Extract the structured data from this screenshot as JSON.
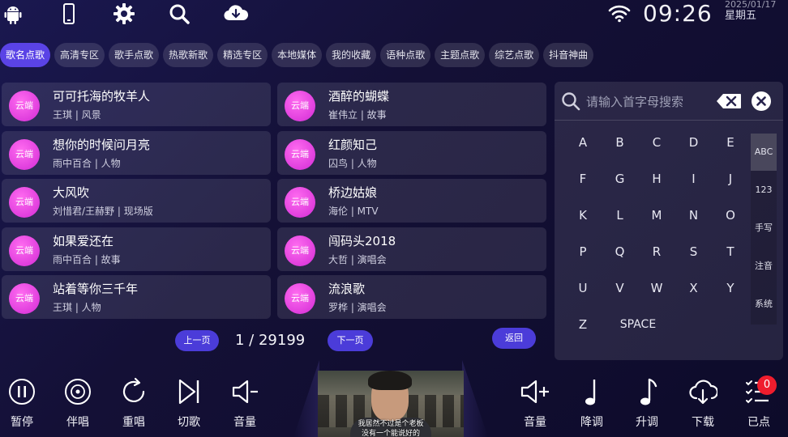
{
  "top_icons": [
    "android-icon",
    "phone-icon",
    "settings-gear-icon",
    "search-icon",
    "cloud-download-icon"
  ],
  "status": {
    "time": "09:26",
    "date": "2025/01/17",
    "weekday": "星期五"
  },
  "tabs": [
    {
      "label": "歌名点歌",
      "active": true
    },
    {
      "label": "高清专区"
    },
    {
      "label": "歌手点歌"
    },
    {
      "label": "热歌新歌"
    },
    {
      "label": "精选专区"
    },
    {
      "label": "本地媒体"
    },
    {
      "label": "我的收藏"
    },
    {
      "label": "语种点歌"
    },
    {
      "label": "主题点歌"
    },
    {
      "label": "综艺点歌"
    },
    {
      "label": "抖音神曲"
    }
  ],
  "songs": [
    {
      "badge": "云端",
      "title": "可可托海的牧羊人",
      "sub": "王琪 | 风景"
    },
    {
      "badge": "云端",
      "title": "酒醉的蝴蝶",
      "sub": "崔伟立 | 故事"
    },
    {
      "badge": "云端",
      "title": "想你的时候问月亮",
      "sub": "雨中百合 | 人物"
    },
    {
      "badge": "云端",
      "title": "红颜知己",
      "sub": "囚鸟 | 人物"
    },
    {
      "badge": "云端",
      "title": "大风吹",
      "sub": "刘惜君/王赫野 | 现场版"
    },
    {
      "badge": "云端",
      "title": "桥边姑娘",
      "sub": "海伦 | MTV"
    },
    {
      "badge": "云端",
      "title": "如果爱还在",
      "sub": "雨中百合 | 故事"
    },
    {
      "badge": "云端",
      "title": "闯码头2018",
      "sub": "大哲 | 演唱会"
    },
    {
      "badge": "云端",
      "title": "站着等你三千年",
      "sub": "王琪 | 人物"
    },
    {
      "badge": "云端",
      "title": "流浪歌",
      "sub": "罗桦 | 演唱会"
    }
  ],
  "pager": {
    "prev": "上一页",
    "next": "下一页",
    "info": "1 / 29199",
    "back": "返回"
  },
  "keyboard": {
    "placeholder": "请输入首字母搜索",
    "keys": [
      "A",
      "B",
      "C",
      "D",
      "E",
      "F",
      "G",
      "H",
      "I",
      "J",
      "K",
      "L",
      "M",
      "N",
      "O",
      "P",
      "Q",
      "R",
      "S",
      "T",
      "U",
      "V",
      "W",
      "X",
      "Y",
      "Z"
    ],
    "space": "SPACE",
    "modes": [
      {
        "label": "ABC",
        "active": true
      },
      {
        "label": "123"
      },
      {
        "label": "手写"
      },
      {
        "label": "注音"
      },
      {
        "label": "系统"
      }
    ]
  },
  "video": {
    "subtitle_line1": "我居然不过是个老板",
    "subtitle_line2": "没有一个能说好的"
  },
  "controls_left": [
    {
      "label": "暂停",
      "icon": "pause-icon"
    },
    {
      "label": "伴唱",
      "icon": "vinyl-icon"
    },
    {
      "label": "重唱",
      "icon": "replay-icon"
    },
    {
      "label": "切歌",
      "icon": "skip-icon"
    },
    {
      "label": "音量",
      "icon": "volume-down-icon"
    }
  ],
  "controls_right": [
    {
      "label": "音量",
      "icon": "volume-up-icon"
    },
    {
      "label": "降调",
      "icon": "note-down-icon"
    },
    {
      "label": "升调",
      "icon": "note-up-icon"
    },
    {
      "label": "下载",
      "icon": "cloud-download-icon"
    },
    {
      "label": "已点",
      "icon": "playlist-icon",
      "count": "0"
    }
  ],
  "colors": {
    "accent": "#5a43e6",
    "badge": "#d22ad5",
    "alert": "#ef1d2d"
  }
}
